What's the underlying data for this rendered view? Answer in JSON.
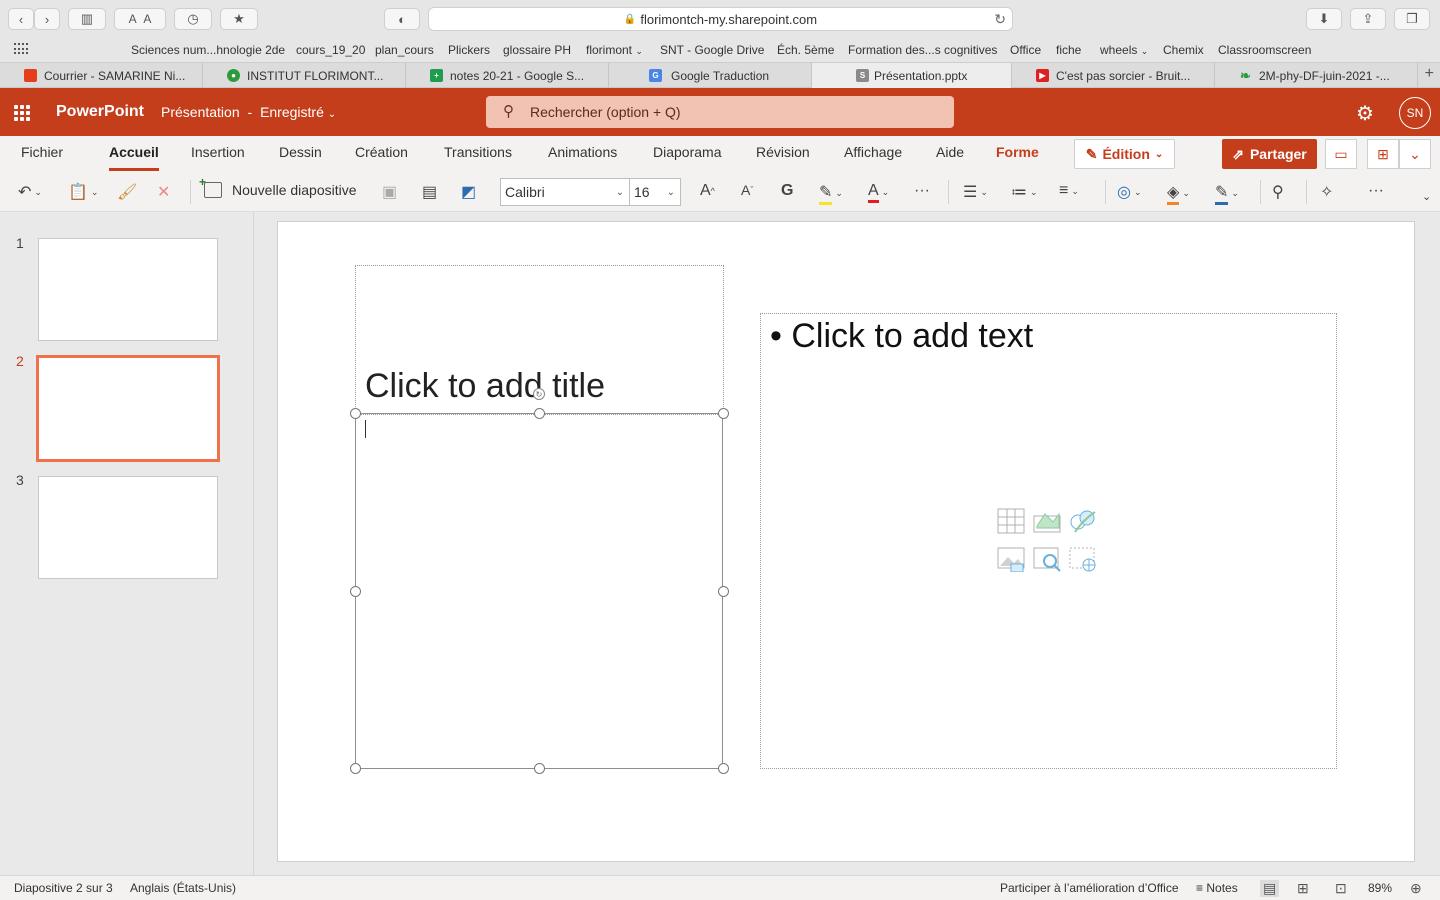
{
  "browser": {
    "address": "florimontch-my.sharepoint.com",
    "bookmarks": [
      "Sciences num...hnologie 2de",
      "cours_19_20",
      "plan_cours",
      "Plickers",
      "glossaire PH",
      "florimont",
      "SNT - Google Drive",
      "Éch. 5ème",
      "Formation des...s cognitives",
      "Office",
      "fiche",
      "wheels",
      "Chemix",
      "Classroomscreen"
    ],
    "tabs": [
      "Courrier - SAMARINE Ni...",
      "INSTITUT FLORIMONT...",
      "notes 20-21 - Google S...",
      "Google Traduction",
      "Présentation.pptx",
      "C'est pas sorcier - Bruit...",
      "2M-phy-DF-juin-2021 -..."
    ]
  },
  "header": {
    "app_name": "PowerPoint",
    "doc_title": "Présentation",
    "separator": "-",
    "save_status": "Enregistré",
    "search_placeholder": "Rechercher (option + Q)",
    "avatar_initials": "SN"
  },
  "ribbon": {
    "tabs": [
      "Fichier",
      "Accueil",
      "Insertion",
      "Dessin",
      "Création",
      "Transitions",
      "Animations",
      "Diaporama",
      "Révision",
      "Affichage",
      "Aide",
      "Forme"
    ],
    "edition": "Édition",
    "share": "Partager",
    "new_slide": "Nouvelle diapositive",
    "font_name": "Calibri",
    "font_size": "16"
  },
  "slides": {
    "numbers": [
      "1",
      "2",
      "3"
    ],
    "active_index": 2
  },
  "slide": {
    "title_placeholder": "Click to add title",
    "text_placeholder": "• Click to add text"
  },
  "status": {
    "slide_info": "Diapositive 2 sur 3",
    "language": "Anglais (États-Unis)",
    "feedback": "Participer à l’amélioration d’Office",
    "notes": "Notes",
    "zoom": "89%"
  },
  "colors": {
    "brand": "#c43e1c",
    "active_thumb": "#f0714c"
  }
}
